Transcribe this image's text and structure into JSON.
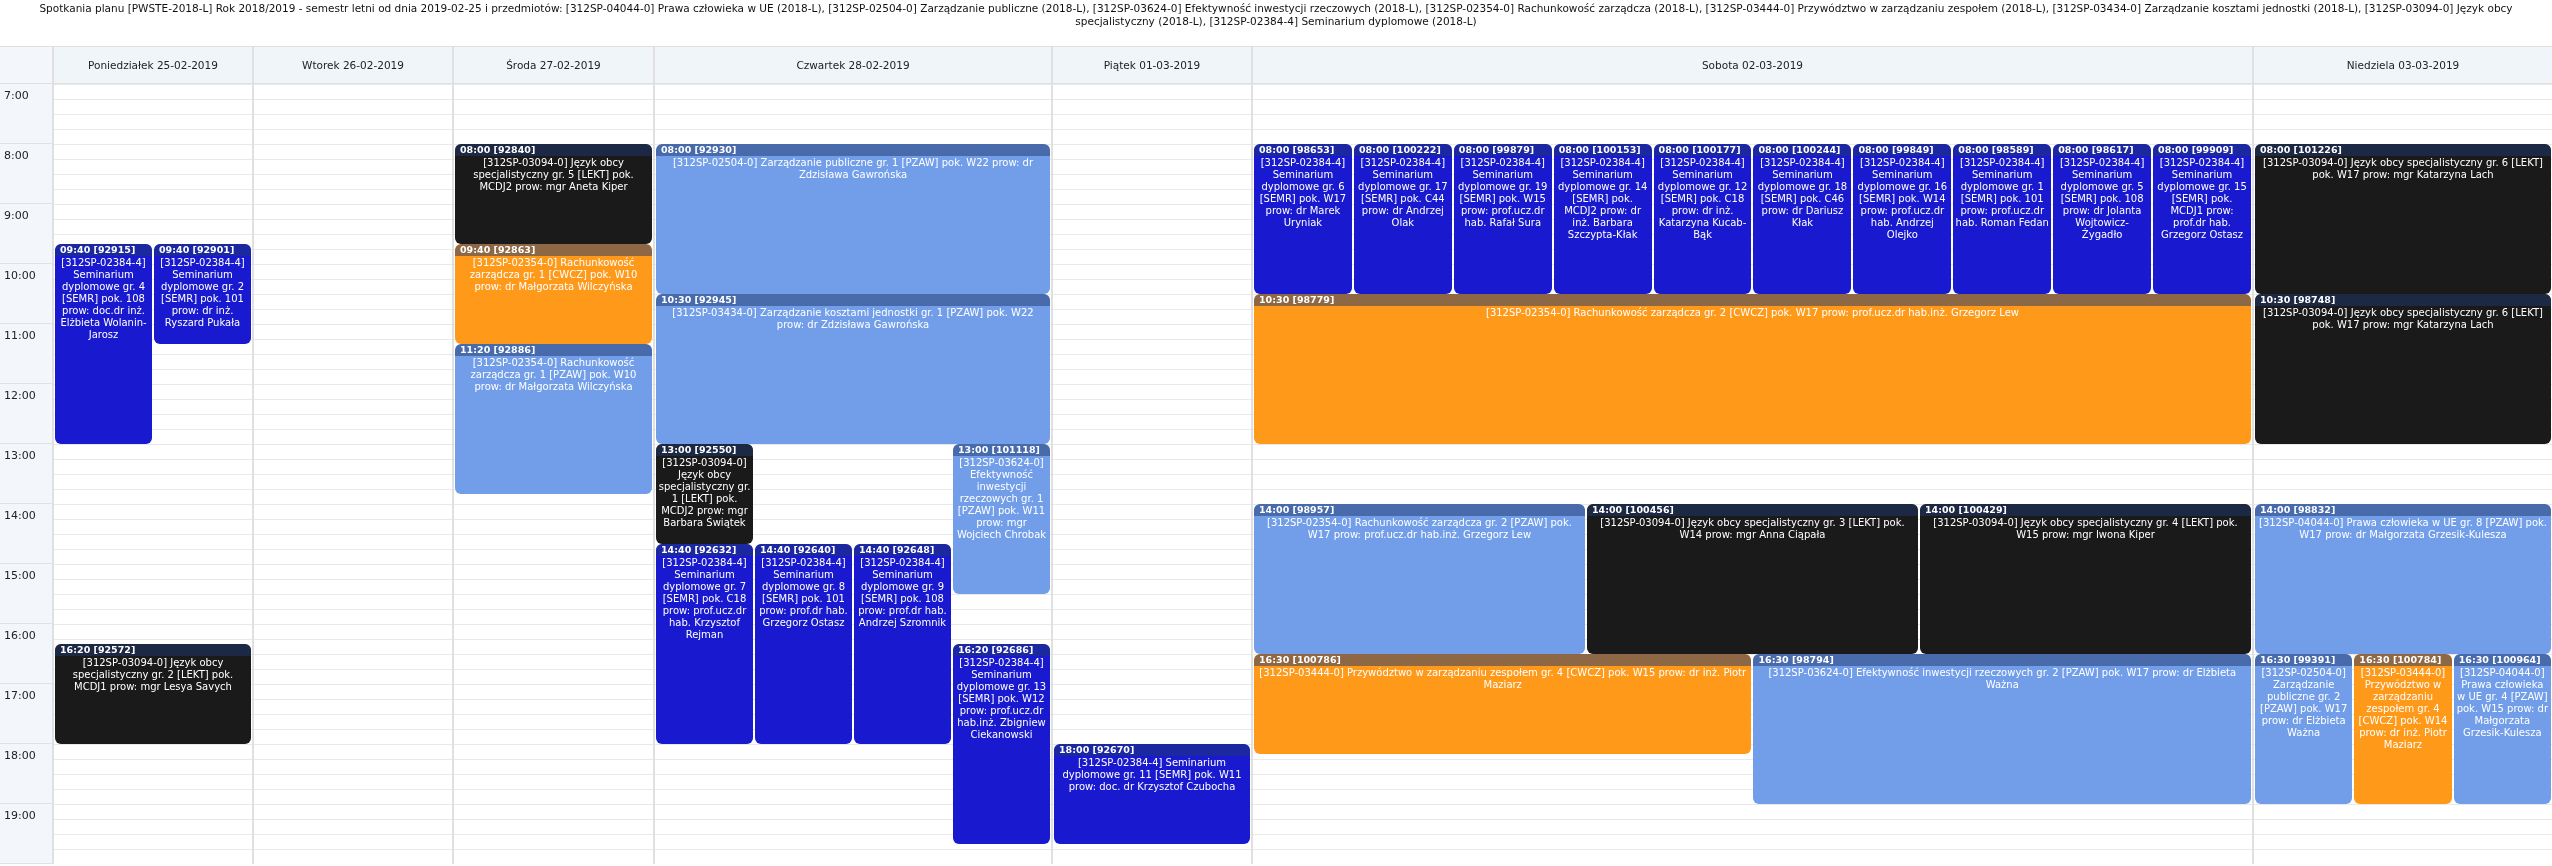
{
  "title": "Spotkania planu [PWSTE-2018-L] Rok 2018/2019 - semestr letni od dnia 2019-02-25 i przedmiotów: [312SP-04044-0] Prawa człowieka w UE (2018-L), [312SP-02504-0] Zarządzanie publiczne (2018-L), [312SP-03624-0] Efektywność inwestycji rzeczowych (2018-L), [312SP-02354-0] Rachunkowość zarządcza (2018-L), [312SP-03444-0] Przywództwo w zarządzaniu zespołem (2018-L), [312SP-03434-0] Zarządzanie kosztami jednostki (2018-L), [312SP-03094-0] Język obcy specjalistyczny (2018-L), [312SP-02384-4] Seminarium dyplomowe (2018-L)",
  "time_labels": [
    "7:00",
    "8:00",
    "9:00",
    "10:00",
    "11:00",
    "12:00",
    "13:00",
    "14:00",
    "15:00",
    "16:00",
    "17:00",
    "18:00",
    "19:00"
  ],
  "days": [
    {
      "label": "Poniedziałek 25-02-2019",
      "events": [
        {
          "start": "09:40",
          "id": "[92915]",
          "kind": "quadruple",
          "color": "#1919d0",
          "text": "[312SP-02384-4] Seminarium dyplomowe gr. 4 [SEMR] pok. 108 prow: doc.dr inż. Elżbieta Wolanin-Jarosz"
        },
        {
          "start": "09:40",
          "id": "[92901]",
          "kind": "double",
          "color": "#1919d0",
          "text": "[312SP-02384-4] Seminarium dyplomowe gr. 2 [SEMR] pok. 101 prow: dr inż. Ryszard Pukała"
        },
        {
          "start": "16:20",
          "id": "[92572]",
          "kind": "double",
          "color": "#1a1a1a",
          "text": "[312SP-03094-0] Język obcy specjalistyczny gr. 2 [LEKT] pok. MCDJ1 prow: mgr Lesya Savych"
        }
      ]
    },
    {
      "label": "Wtorek 26-02-2019"
    },
    {
      "label": "Środa 27-02-2019",
      "events": [
        {
          "start": "08:00",
          "id": "[92840]",
          "kind": "double",
          "color": "#1a1a1a",
          "text": "[312SP-03094-0] Język obcy specjalistyczny gr. 5 [LEKT] pok. MCDJ2 prow: mgr Aneta Kiper"
        },
        {
          "start": "09:40",
          "id": "[92863]",
          "kind": "double",
          "color": "#ff991a",
          "text": "[312SP-02354-0] Rachunkowość zarządcza gr. 1 [CWCZ] pok. W10 prow: dr Małgorzata Wilczyńska"
        },
        {
          "start": "11:20",
          "id": "[92886]",
          "kind": "triple",
          "color": "#729ee9",
          "text": "[312SP-02354-0] Rachunkowość zarządcza gr. 1 [PZAW] pok. W10 prow: dr Małgorzata Wilczyńska"
        }
      ]
    },
    {
      "label": "Czwartek 28-02-2019",
      "events": [
        {
          "start": "08:00",
          "id": "[92930]",
          "kind": "triple",
          "color": "#729ee9",
          "text": "[312SP-02504-0] Zarządzanie publiczne gr. 1 [PZAW] pok. W22 prow: dr Zdzisława Gawrońska"
        },
        {
          "start": "10:30",
          "id": "[92945]",
          "kind": "triple",
          "color": "#729ee9",
          "text": "[312SP-03434-0] Zarządzanie kosztami jednostki gr. 1 [PZAW] pok. W22 prow: dr Zdzisława Gawrońska"
        },
        {
          "start": "13:00",
          "id": "[92550]",
          "kind": "double",
          "color": "#1a1a1a",
          "text": "[312SP-03094-0] Język obcy specjalistyczny gr. 1 [LEKT] pok. MCDJ2 prow: mgr Barbara Świątek"
        },
        {
          "start": "14:40",
          "id": "[92632]",
          "kind": "quadruple",
          "color": "#1919d0",
          "text": "[312SP-02384-4] Seminarium dyplomowe gr. 7 [SEMR] pok. C18 prow: prof.ucz.dr hab. Krzysztof Rejman"
        },
        {
          "start": "14:40",
          "id": "[92640]",
          "kind": "quadruple",
          "color": "#1919d0",
          "text": "[312SP-02384-4] Seminarium dyplomowe gr. 8 [SEMR] pok. 101 prow: prof.dr hab. Grzegorz Ostasz"
        },
        {
          "start": "14:40",
          "id": "[92648]",
          "kind": "quadruple",
          "color": "#1919d0",
          "text": "[312SP-02384-4] Seminarium dyplomowe gr. 9 [SEMR] pok. 108 prow: prof.dr hab. Andrzej Szromnik"
        },
        {
          "start": "13:00",
          "id": "[101118]",
          "kind": "triple",
          "color": "#729ee9",
          "text": "[312SP-03624-0] Efektywność inwestycji rzeczowych gr. 1 [PZAW] pok. W11 prow: mgr Wojciech Chrobak"
        },
        {
          "start": "16:20",
          "id": "[92686]",
          "kind": "quadruple",
          "color": "#1919d0",
          "text": "[312SP-02384-4] Seminarium dyplomowe gr. 13 [SEMR] pok. W12 prow: prof.ucz.dr hab.inż. Zbigniew Ciekanowski"
        }
      ]
    },
    {
      "label": "Piątek 01-03-2019",
      "events": [
        {
          "start": "18:00",
          "id": "[92670]",
          "kind": "double",
          "color": "#1919d0",
          "text": "[312SP-02384-4] Seminarium dyplomowe gr. 11 [SEMR] pok. W11 prow: doc. dr Krzysztof Czubocha"
        }
      ]
    },
    {
      "label": "Sobota 02-03-2019",
      "events": [
        {
          "start": "08:00",
          "id": "[98653]",
          "kind": "triple",
          "color": "#1919d0",
          "text": "[312SP-02384-4] Seminarium dyplomowe gr. 6 [SEMR] pok. W17 prow: dr Marek Uryniak"
        },
        {
          "start": "08:00",
          "id": "[100222]",
          "kind": "triple",
          "color": "#1919d0",
          "text": "[312SP-02384-4] Seminarium dyplomowe gr. 17 [SEMR] pok. C44 prow: dr Andrzej Olak"
        },
        {
          "start": "08:00",
          "id": "[99879]",
          "kind": "triple",
          "color": "#1919d0",
          "text": "[312SP-02384-4] Seminarium dyplomowe gr. 19 [SEMR] pok. W15 prow: prof.ucz.dr hab. Rafał Sura"
        },
        {
          "start": "08:00",
          "id": "[100153]",
          "kind": "triple",
          "color": "#1919d0",
          "text": "[312SP-02384-4] Seminarium dyplomowe gr. 14 [SEMR] pok. MCDJ2 prow: dr inż. Barbara Szczypta-Kłak"
        },
        {
          "start": "08:00",
          "id": "[100177]",
          "kind": "triple",
          "color": "#1919d0",
          "text": "[312SP-02384-4] Seminarium dyplomowe gr. 12 [SEMR] pok. C18 prow: dr inż. Katarzyna Kucab-Bąk"
        },
        {
          "start": "08:00",
          "id": "[100244]",
          "kind": "triple",
          "color": "#1919d0",
          "text": "[312SP-02384-4] Seminarium dyplomowe gr. 18 [SEMR] pok. C46 prow: dr Dariusz Kłak"
        },
        {
          "start": "08:00",
          "id": "[99849]",
          "kind": "triple",
          "color": "#1919d0",
          "text": "[312SP-02384-4] Seminarium dyplomowe gr. 16 [SEMR] pok. W14 prow: prof.ucz.dr hab. Andrzej Olejko"
        },
        {
          "start": "08:00",
          "id": "[98589]",
          "kind": "triple",
          "color": "#1919d0",
          "text": "[312SP-02384-4] Seminarium dyplomowe gr. 1 [SEMR] pok. 101 prow: prof.ucz.dr hab. Roman Fedan"
        },
        {
          "start": "08:00",
          "id": "[98617]",
          "kind": "triple",
          "color": "#1919d0",
          "text": "[312SP-02384-4] Seminarium dyplomowe gr. 5 [SEMR] pok. 108 prow: dr Jolanta Wojtowicz-Żygadło"
        },
        {
          "start": "08:00",
          "id": "[99909]",
          "kind": "triple",
          "color": "#1919d0",
          "text": "[312SP-02384-4] Seminarium dyplomowe gr. 15 [SEMR] pok. MCDJ1 prow: prof.dr hab. Grzegorz Ostasz"
        },
        {
          "start": "10:30",
          "id": "[98779]",
          "kind": "triple",
          "color": "#ff991a",
          "text": "[312SP-02354-0] Rachunkowość zarządcza gr. 2 [CWCZ] pok. W17 prow: prof.ucz.dr hab.inż. Grzegorz Lew"
        },
        {
          "start": "14:00",
          "id": "[98957]",
          "kind": "triple",
          "color": "#729ee9",
          "text": "[312SP-02354-0] Rachunkowość zarządcza gr. 2 [PZAW] pok. W17 prow: prof.ucz.dr hab.inż. Grzegorz Lew"
        },
        {
          "start": "14:00",
          "id": "[100456]",
          "kind": "triple",
          "color": "#1a1a1a",
          "text": "[312SP-03094-0] Język obcy specjalistyczny gr. 3 [LEKT] pok. W14 prow: mgr Anna Ciąpała"
        },
        {
          "start": "14:00",
          "id": "[100429]",
          "kind": "triple",
          "color": "#1a1a1a",
          "text": "[312SP-03094-0] Język obcy specjalistyczny gr. 4 [LEKT] pok. W15 prow: mgr Iwona Kiper"
        },
        {
          "start": "16:30",
          "id": "[100786]",
          "kind": "double",
          "color": "#ff991a",
          "text": "[312SP-03444-0] Przywództwo w zarządzaniu zespołem gr. 4 [CWCZ] pok. W15 prow: dr inż. Piotr Maziarz"
        },
        {
          "start": "16:30",
          "id": "[98794]",
          "kind": "triple",
          "color": "#729ee9",
          "text": "[312SP-03624-0] Efektywność inwestycji rzeczowych gr. 2 [PZAW] pok. W17 prow: dr Elżbieta Ważna"
        }
      ]
    },
    {
      "label": "Niedziela 03-03-2019",
      "events": [
        {
          "start": "08:00",
          "id": "[101226]",
          "kind": "triple",
          "color": "#1a1a1a",
          "text": "[312SP-03094-0] Język obcy specjalistyczny gr. 6 [LEKT] pok. W17 prow: mgr Katarzyna Lach"
        },
        {
          "start": "10:30",
          "id": "[98748]",
          "kind": "triple",
          "color": "#1a1a1a",
          "text": "[312SP-03094-0] Język obcy specjalistyczny gr. 6 [LEKT] pok. W17 prow: mgr Katarzyna Lach"
        },
        {
          "start": "14:00",
          "id": "[98832]",
          "kind": "triple",
          "color": "#729ee9",
          "text": "[312SP-04044-0] Prawa człowieka w UE gr. 8 [PZAW] pok. W17 prow: dr Małgorzata Grzesik-Kulesza"
        },
        {
          "start": "16:30",
          "id": "[99391]",
          "kind": "triple",
          "color": "#729ee9",
          "text": "[312SP-02504-0] Zarządzanie publiczne gr. 2 [PZAW] pok. W17 prow: dr Elżbieta Ważna"
        },
        {
          "start": "16:30",
          "id": "[100784]",
          "kind": "triple",
          "color": "#ff991a",
          "text": "[312SP-03444-0] Przywództwo w zarządzaniu zespołem gr. 4 [CWCZ] pok. W14 prow: dr inż. Piotr Maziarz"
        },
        {
          "start": "16:30",
          "id": "[100964]",
          "kind": "triple",
          "color": "#729ee9",
          "text": "[312SP-04044-0] Prawa człowieka w UE gr. 4 [PZAW] pok. W15 prow: dr Małgorzata Grzesik-Kulesza"
        }
      ]
    }
  ]
}
